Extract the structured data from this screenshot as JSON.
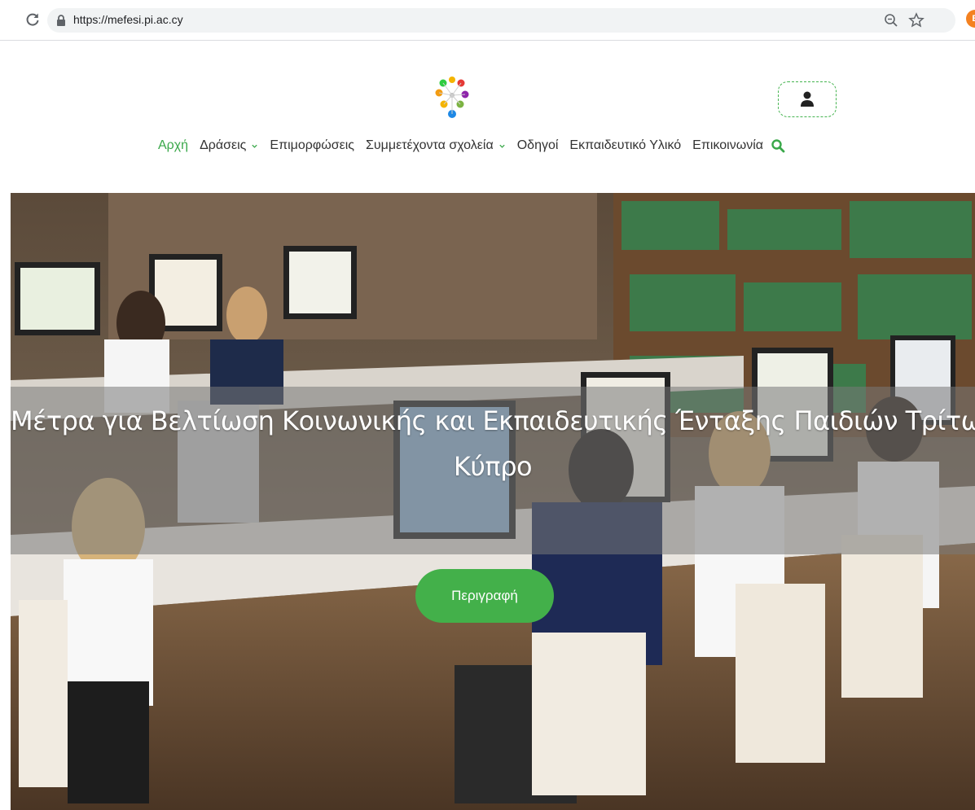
{
  "browser": {
    "url": "https://mefesi.pi.ac.cy",
    "profile_initial": "E"
  },
  "nav": {
    "items": [
      {
        "label": "Αρχή",
        "active": true,
        "dropdown": false
      },
      {
        "label": "Δράσεις",
        "active": false,
        "dropdown": true
      },
      {
        "label": "Επιμορφώσεις",
        "active": false,
        "dropdown": false
      },
      {
        "label": "Συμμετέχοντα σχολεία",
        "active": false,
        "dropdown": true
      },
      {
        "label": "Οδηγοί",
        "active": false,
        "dropdown": false
      },
      {
        "label": "Εκπαιδευτικό Υλικό",
        "active": false,
        "dropdown": false
      },
      {
        "label": "Επικοινωνία",
        "active": false,
        "dropdown": false
      }
    ]
  },
  "hero": {
    "title_line1": "Μέτρα για Βελτίωση Κοινωνικής και Εκπαιδευτικής Ένταξης Παιδιών Τρίτων Χωρών στην",
    "title_line2": "Κύπρο",
    "button_label": "Περιγραφή"
  },
  "icons": {
    "reload": "reload-icon",
    "lock": "lock-icon",
    "zoom": "zoom-icon",
    "star": "star-icon",
    "user": "user-icon",
    "search": "search-icon",
    "chevron": "chevron-down-icon"
  },
  "colors": {
    "accent_green": "#43b04a",
    "nav_active": "#3aa84a",
    "nav_text": "#333333",
    "profile": "#f48120"
  }
}
